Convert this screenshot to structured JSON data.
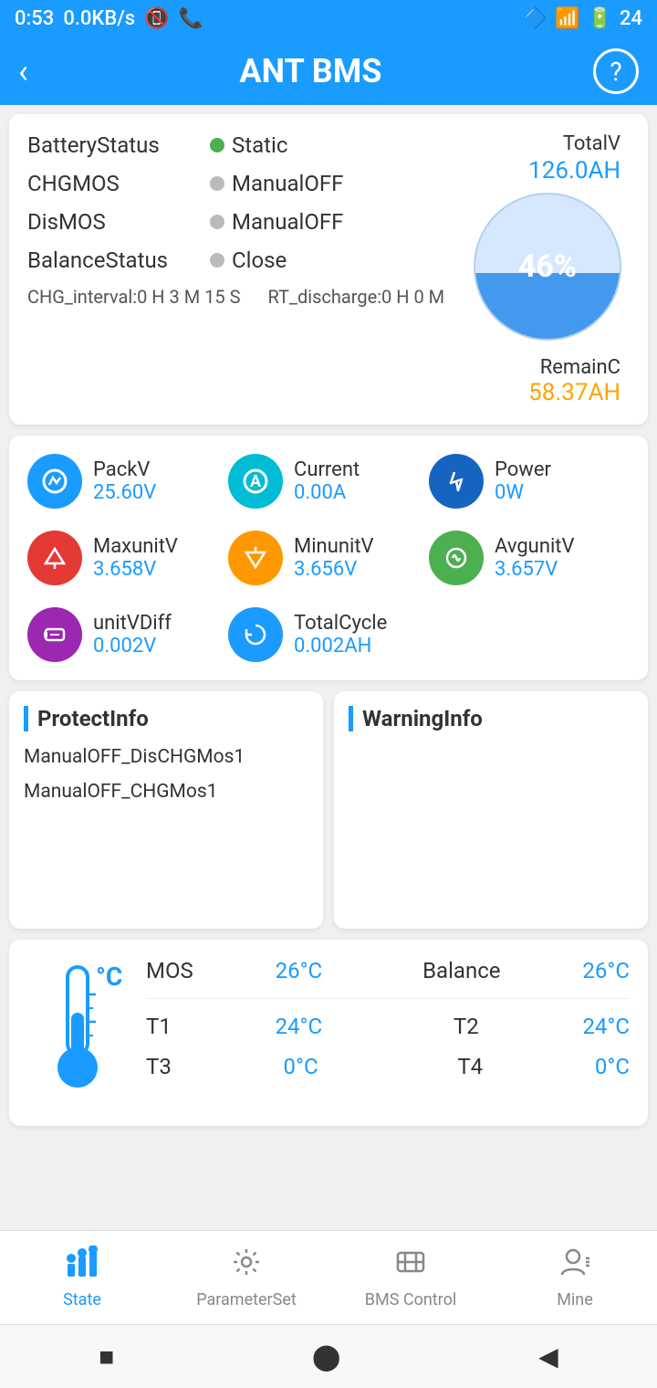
{
  "statusBar": {
    "time": "0:53",
    "network": "0.0KB/s",
    "battery": "24"
  },
  "appBar": {
    "title": "ANT BMS",
    "backLabel": "‹",
    "helpLabel": "?"
  },
  "batteryStatus": {
    "batteryStatusLabel": "BatteryStatus",
    "batteryStatusValue": "Static",
    "chgmosLabel": "CHGMOS",
    "chgmosValue": "ManualOFF",
    "dismosLabel": "DisMOS",
    "dismosValue": "ManualOFF",
    "balanceStatusLabel": "BalanceStatus",
    "balanceStatusValue": "Close",
    "intervalLabel": "CHG_interval:0 H 3 M 15 S",
    "rtDischargeLabel": "RT_discharge:0 H 0 M",
    "totalVLabel": "TotalV",
    "totalAH": "126.0AH",
    "remainCLabel": "RemainC",
    "remainAH": "58.37AH",
    "piePercent": "46%",
    "pieValue": 46
  },
  "metrics": [
    {
      "label": "PackV",
      "value": "25.60V",
      "iconType": "voltage",
      "iconColor": "icon-blue"
    },
    {
      "label": "Current",
      "value": "0.00A",
      "iconType": "current",
      "iconColor": "icon-teal"
    },
    {
      "label": "Power",
      "value": "0W",
      "iconType": "power",
      "iconColor": "icon-darkblue"
    },
    {
      "label": "MaxunitV",
      "value": "3.658V",
      "iconType": "maxv",
      "iconColor": "icon-red"
    },
    {
      "label": "MinunitV",
      "value": "3.656V",
      "iconType": "minv",
      "iconColor": "icon-orange"
    },
    {
      "label": "AvgunitV",
      "value": "3.657V",
      "iconType": "avgv",
      "iconColor": "icon-green"
    },
    {
      "label": "unitVDiff",
      "value": "0.002V",
      "iconType": "diff",
      "iconColor": "icon-purple"
    },
    {
      "label": "TotalCycle",
      "value": "0.002AH",
      "iconType": "cycle",
      "iconColor": "icon-blue"
    }
  ],
  "protectInfo": {
    "title": "ProtectInfo",
    "items": [
      "ManualOFF_DisCHGMos1",
      "ManualOFF_CHGMos1"
    ]
  },
  "warningInfo": {
    "title": "WarningInfo",
    "items": []
  },
  "temperature": {
    "mosLabel": "MOS",
    "mosValue": "26°C",
    "balanceLabel": "Balance",
    "balanceValue": "26°C",
    "t1Label": "T1",
    "t1Value": "24°C",
    "t2Label": "T2",
    "t2Value": "24°C",
    "t3Label": "T3",
    "t3Value": "0°C",
    "t4Label": "T4",
    "t4Value": "0°C"
  },
  "bottomNav": {
    "items": [
      {
        "label": "State",
        "active": true
      },
      {
        "label": "ParameterSet",
        "active": false
      },
      {
        "label": "BMS Control",
        "active": false
      },
      {
        "label": "Mine",
        "active": false
      }
    ]
  },
  "sysNav": {
    "stopBtn": "■",
    "homeBtn": "⬤",
    "backBtn": "◀"
  }
}
